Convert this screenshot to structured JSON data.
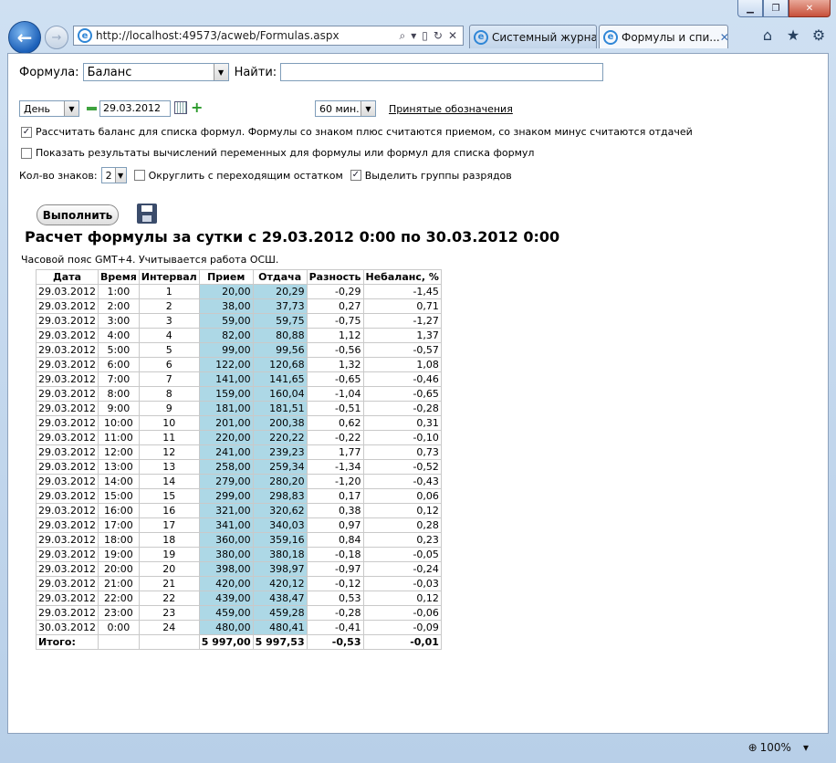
{
  "browser": {
    "address": "http://localhost:49573/acweb/Formulas.aspx",
    "tabs": [
      {
        "label": "Системный журнал"
      },
      {
        "label": "Формулы и спи..."
      }
    ],
    "zoom": "100%"
  },
  "form": {
    "formula_label": "Формула:",
    "formula_value": "Баланс",
    "search_label": "Найти:",
    "search_value": "",
    "period": "День",
    "date": "29.03.2012",
    "interval": "60 мин.",
    "legend_link": "Принятые обозначения",
    "calc_balance_label": "Рассчитать баланс для списка формул. Формулы со знаком плюс считаются приемом, со знаком минус считаются отдачей",
    "calc_balance_checked": true,
    "show_vars_label": "Показать результаты вычислений переменных для формулы или формул для списка формул",
    "show_vars_checked": false,
    "digits_label": "Кол-во знаков:",
    "digits_value": "2",
    "round_label": "Округлить с переходящим остатком",
    "round_checked": false,
    "groups_label": "Выделить группы разрядов",
    "groups_checked": true,
    "execute_label": "Выполнить"
  },
  "result": {
    "title": "Расчет формулы за сутки с 29.03.2012 0:00 по 30.03.2012 0:00",
    "timezone": "Часовой пояс GMT+4. Учитывается работа ОСШ.",
    "columns": [
      "Дата",
      "Время",
      "Интервал",
      "Прием",
      "Отдача",
      "Разность",
      "Небаланс, %"
    ],
    "rows": [
      [
        "29.03.2012",
        "1:00",
        "1",
        "20,00",
        "20,29",
        "-0,29",
        "-1,45"
      ],
      [
        "29.03.2012",
        "2:00",
        "2",
        "38,00",
        "37,73",
        "0,27",
        "0,71"
      ],
      [
        "29.03.2012",
        "3:00",
        "3",
        "59,00",
        "59,75",
        "-0,75",
        "-1,27"
      ],
      [
        "29.03.2012",
        "4:00",
        "4",
        "82,00",
        "80,88",
        "1,12",
        "1,37"
      ],
      [
        "29.03.2012",
        "5:00",
        "5",
        "99,00",
        "99,56",
        "-0,56",
        "-0,57"
      ],
      [
        "29.03.2012",
        "6:00",
        "6",
        "122,00",
        "120,68",
        "1,32",
        "1,08"
      ],
      [
        "29.03.2012",
        "7:00",
        "7",
        "141,00",
        "141,65",
        "-0,65",
        "-0,46"
      ],
      [
        "29.03.2012",
        "8:00",
        "8",
        "159,00",
        "160,04",
        "-1,04",
        "-0,65"
      ],
      [
        "29.03.2012",
        "9:00",
        "9",
        "181,00",
        "181,51",
        "-0,51",
        "-0,28"
      ],
      [
        "29.03.2012",
        "10:00",
        "10",
        "201,00",
        "200,38",
        "0,62",
        "0,31"
      ],
      [
        "29.03.2012",
        "11:00",
        "11",
        "220,00",
        "220,22",
        "-0,22",
        "-0,10"
      ],
      [
        "29.03.2012",
        "12:00",
        "12",
        "241,00",
        "239,23",
        "1,77",
        "0,73"
      ],
      [
        "29.03.2012",
        "13:00",
        "13",
        "258,00",
        "259,34",
        "-1,34",
        "-0,52"
      ],
      [
        "29.03.2012",
        "14:00",
        "14",
        "279,00",
        "280,20",
        "-1,20",
        "-0,43"
      ],
      [
        "29.03.2012",
        "15:00",
        "15",
        "299,00",
        "298,83",
        "0,17",
        "0,06"
      ],
      [
        "29.03.2012",
        "16:00",
        "16",
        "321,00",
        "320,62",
        "0,38",
        "0,12"
      ],
      [
        "29.03.2012",
        "17:00",
        "17",
        "341,00",
        "340,03",
        "0,97",
        "0,28"
      ],
      [
        "29.03.2012",
        "18:00",
        "18",
        "360,00",
        "359,16",
        "0,84",
        "0,23"
      ],
      [
        "29.03.2012",
        "19:00",
        "19",
        "380,00",
        "380,18",
        "-0,18",
        "-0,05"
      ],
      [
        "29.03.2012",
        "20:00",
        "20",
        "398,00",
        "398,97",
        "-0,97",
        "-0,24"
      ],
      [
        "29.03.2012",
        "21:00",
        "21",
        "420,00",
        "420,12",
        "-0,12",
        "-0,03"
      ],
      [
        "29.03.2012",
        "22:00",
        "22",
        "439,00",
        "438,47",
        "0,53",
        "0,12"
      ],
      [
        "29.03.2012",
        "23:00",
        "23",
        "459,00",
        "459,28",
        "-0,28",
        "-0,06"
      ],
      [
        "30.03.2012",
        "0:00",
        "24",
        "480,00",
        "480,41",
        "-0,41",
        "-0,09"
      ]
    ],
    "total": [
      "Итого:",
      "",
      "",
      "5 997,00",
      "5 997,53",
      "-0,53",
      "-0,01"
    ]
  }
}
